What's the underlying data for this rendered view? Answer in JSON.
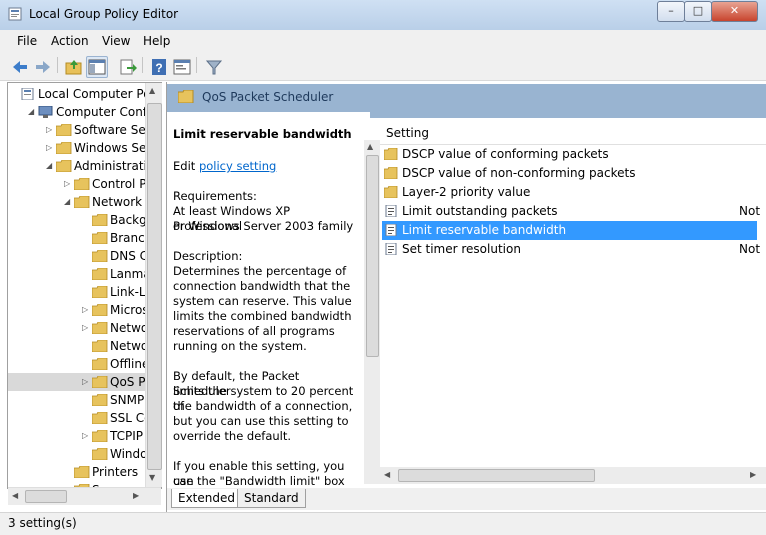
{
  "window": {
    "title": "Local Group Policy Editor",
    "buttons": {
      "minimize": "–",
      "maximize": "□",
      "close": "✕"
    }
  },
  "menu": [
    "File",
    "Action",
    "View",
    "Help"
  ],
  "toolbar": {
    "icons": [
      "back-icon",
      "forward-icon",
      "up-folder-icon",
      "show-hide-tree-icon",
      "export-list-icon",
      "help-icon",
      "properties-icon",
      "filter-icon"
    ]
  },
  "tree": {
    "items": [
      {
        "label": "Local Computer Polic",
        "indent": 0,
        "expander": "",
        "icon": "policy"
      },
      {
        "label": "Computer Config",
        "indent": 1,
        "expander": "◢",
        "icon": "computer"
      },
      {
        "label": "Software Setti",
        "indent": 2,
        "expander": "▷",
        "icon": "folder"
      },
      {
        "label": "Windows Sett",
        "indent": 2,
        "expander": "▷",
        "icon": "folder"
      },
      {
        "label": "Administrative",
        "indent": 2,
        "expander": "◢",
        "icon": "folder"
      },
      {
        "label": "Control Pa",
        "indent": 3,
        "expander": "▷",
        "icon": "folder"
      },
      {
        "label": "Network",
        "indent": 3,
        "expander": "◢",
        "icon": "folder"
      },
      {
        "label": "Backgr",
        "indent": 4,
        "expander": "",
        "icon": "folder"
      },
      {
        "label": "Branch",
        "indent": 4,
        "expander": "",
        "icon": "folder"
      },
      {
        "label": "DNS C",
        "indent": 4,
        "expander": "",
        "icon": "folder"
      },
      {
        "label": "Lanma",
        "indent": 4,
        "expander": "",
        "icon": "folder"
      },
      {
        "label": "Link-La",
        "indent": 4,
        "expander": "",
        "icon": "folder"
      },
      {
        "label": "Micros",
        "indent": 4,
        "expander": "▷",
        "icon": "folder"
      },
      {
        "label": "Netwo",
        "indent": 4,
        "expander": "▷",
        "icon": "folder"
      },
      {
        "label": "Netwo",
        "indent": 4,
        "expander": "",
        "icon": "folder"
      },
      {
        "label": "Offline",
        "indent": 4,
        "expander": "",
        "icon": "folder"
      },
      {
        "label": "QoS Pa",
        "indent": 4,
        "expander": "▷",
        "icon": "folder",
        "selected": true
      },
      {
        "label": "SNMP",
        "indent": 4,
        "expander": "",
        "icon": "folder"
      },
      {
        "label": "SSL Co",
        "indent": 4,
        "expander": "",
        "icon": "folder"
      },
      {
        "label": "TCPIP",
        "indent": 4,
        "expander": "▷",
        "icon": "folder"
      },
      {
        "label": "Windo",
        "indent": 4,
        "expander": "",
        "icon": "folder"
      },
      {
        "label": "Printers",
        "indent": 3,
        "expander": "",
        "icon": "folder"
      },
      {
        "label": "Sy",
        "indent": 3,
        "expander": "",
        "icon": "folder"
      }
    ]
  },
  "header": {
    "title": "QoS Packet Scheduler"
  },
  "description": {
    "title": "Limit reservable bandwidth",
    "edit_prefix": "Edit",
    "edit_link": "policy setting",
    "lines": [
      {
        "text": "Requirements:"
      },
      {
        "text": "At least Windows XP Professional"
      },
      {
        "text": "or Windows Server 2003 family"
      },
      {
        "text": ""
      },
      {
        "text": "Description:"
      },
      {
        "text": "Determines the percentage of"
      },
      {
        "text": "connection bandwidth that the"
      },
      {
        "text": "system can reserve. This value"
      },
      {
        "text": "limits the combined bandwidth"
      },
      {
        "text": "reservations of all programs"
      },
      {
        "text": "running on the system."
      },
      {
        "text": ""
      },
      {
        "text": "By default, the Packet Scheduler"
      },
      {
        "text": "limits the system to 20 percent of"
      },
      {
        "text": "the bandwidth of a connection,"
      },
      {
        "text": "but you can use this setting to"
      },
      {
        "text": "override the default."
      },
      {
        "text": ""
      },
      {
        "text": "If you enable this setting, you can"
      },
      {
        "text": "use the \"Bandwidth limit\" box to"
      }
    ]
  },
  "list": {
    "column_setting": "Setting",
    "rows": [
      {
        "label": "DSCP value of conforming packets",
        "type": "folder",
        "state": ""
      },
      {
        "label": "DSCP value of non-conforming packets",
        "type": "folder",
        "state": ""
      },
      {
        "label": "Layer-2 priority value",
        "type": "folder",
        "state": ""
      },
      {
        "label": "Limit outstanding packets",
        "type": "setting",
        "state": "Not"
      },
      {
        "label": "Limit reservable bandwidth",
        "type": "setting",
        "state": "",
        "selected": true
      },
      {
        "label": "Set timer resolution",
        "type": "setting",
        "state": "Not"
      }
    ]
  },
  "tabs": [
    "Extended",
    "Standard"
  ],
  "status": {
    "text": "3 setting(s)"
  },
  "colors": {
    "selection": "#3399ff",
    "header_band": "#99b4d1",
    "link": "#0066cc"
  }
}
